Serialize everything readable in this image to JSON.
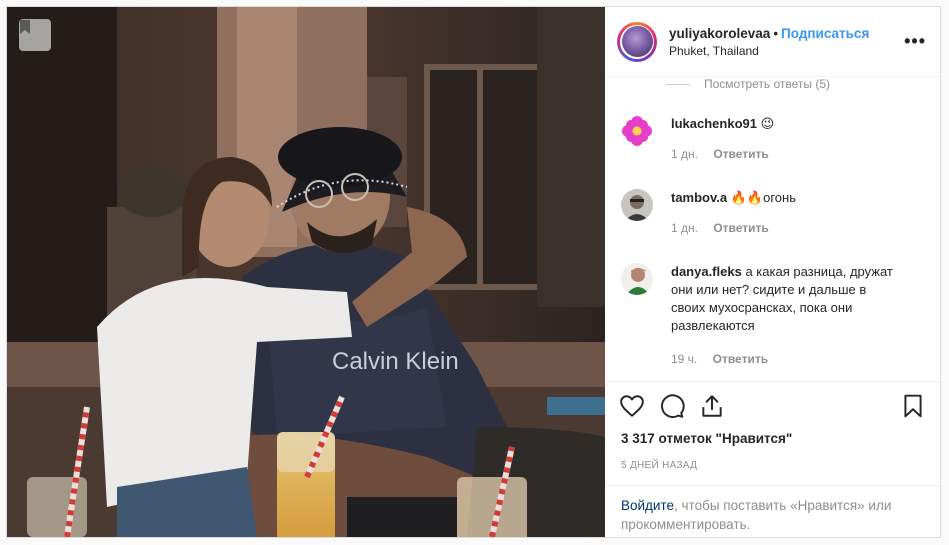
{
  "header": {
    "username": "yuliyakorolevaa",
    "separator": "•",
    "follow_label": "Подписаться",
    "location": "Phuket, Thailand",
    "more_label": "•••"
  },
  "thread": {
    "view_replies": "Посмотреть ответы (5)"
  },
  "comments": [
    {
      "user": "lukachenko91",
      "text": "😉",
      "time": "1 дн.",
      "reply": "Ответить"
    },
    {
      "user": "tambov.a",
      "text": "🔥🔥огонь",
      "time": "1 дн.",
      "reply": "Ответить"
    },
    {
      "user": "danya.fleks",
      "text": "а какая разница, дружат они или нет? сидите и дальше в своих мухосрансках, пока они развлекаются",
      "time": "19 ч.",
      "reply": "Ответить"
    }
  ],
  "actions": {
    "icons": [
      "heart-icon",
      "comment-icon",
      "share-icon",
      "bookmark-icon"
    ]
  },
  "likes": "3 317 отметок \"Нравится\"",
  "posted_ago": "5 ДНЕЙ НАЗАД",
  "login": {
    "link": "Войдите",
    "rest": ", чтобы поставить «Нравится» или прокомментировать."
  },
  "photo": {
    "shirt_text": "Calvin Klein"
  },
  "colors": {
    "accent": "#3897f0",
    "link": "#003569",
    "muted": "#8e8e8e"
  }
}
